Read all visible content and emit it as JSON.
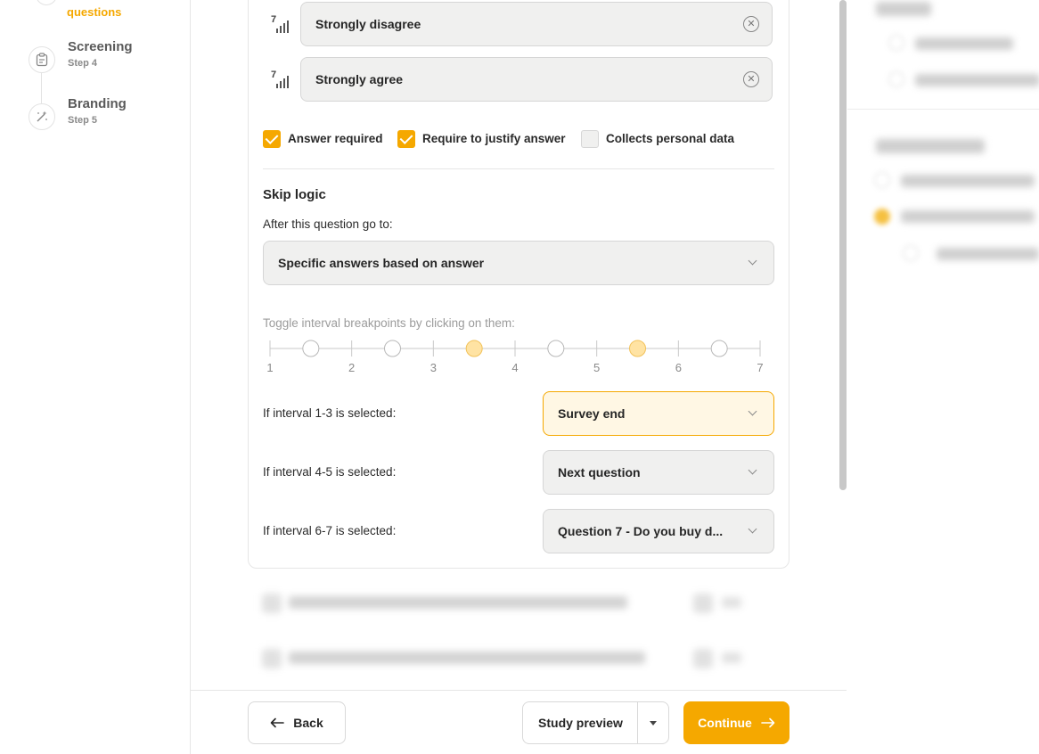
{
  "sidebar": {
    "prev_step_label": "questions",
    "steps": [
      {
        "title": "Screening",
        "sub": "Step 4"
      },
      {
        "title": "Branding",
        "sub": "Step 5"
      }
    ]
  },
  "question": {
    "options": [
      "Strongly disagree",
      "Strongly agree"
    ],
    "checkboxes": [
      {
        "label": "Answer required",
        "checked": true
      },
      {
        "label": "Require to justify answer",
        "checked": true
      },
      {
        "label": "Collects personal data",
        "checked": false
      }
    ]
  },
  "skip_logic": {
    "title": "Skip logic",
    "after_label": "After this question go to:",
    "mode_value": "Specific answers based on answer",
    "toggle_hint": "Toggle interval breakpoints by clicking on them:",
    "scale": [
      "1",
      "2",
      "3",
      "4",
      "5",
      "6",
      "7"
    ],
    "breakpoints_active": [
      false,
      false,
      true,
      false,
      true,
      false
    ],
    "intervals": [
      {
        "label": "If interval 1-3 is selected:",
        "value": "Survey end"
      },
      {
        "label": "If interval 4-5 is selected:",
        "value": "Next question"
      },
      {
        "label": "If interval 6-7 is selected:",
        "value": "Question 7 - Do you buy d..."
      }
    ]
  },
  "footer": {
    "back": "Back",
    "preview": "Study preview",
    "continue": "Continue"
  },
  "colors": {
    "accent": "#f5a800",
    "accent_light": "#ffe3a3"
  }
}
